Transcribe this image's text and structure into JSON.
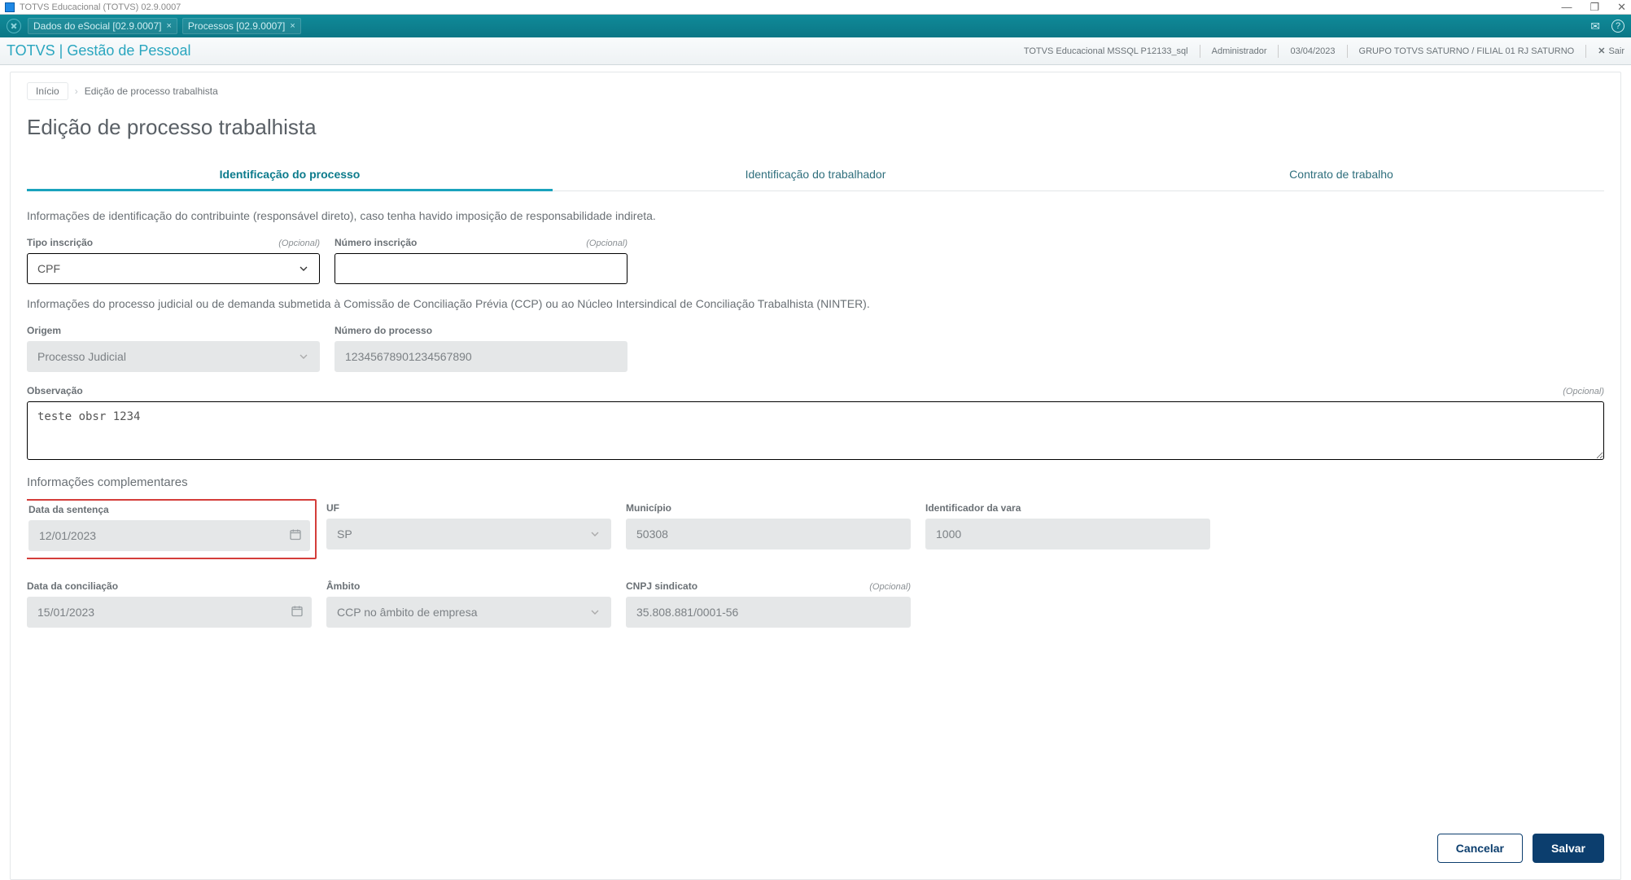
{
  "window": {
    "title": "TOTVS Educacional (TOTVS) 02.9.0007"
  },
  "ribbon": {
    "tabs": [
      {
        "label": "Dados do eSocial [02.9.0007]"
      },
      {
        "label": "Processos [02.9.0007]"
      }
    ]
  },
  "header": {
    "brand": "TOTVS | Gestão de Pessoal",
    "env": "TOTVS Educacional MSSQL P12133_sql",
    "user": "Administrador",
    "date": "03/04/2023",
    "company": "GRUPO TOTVS SATURNO / FILIAL 01 RJ SATURNO",
    "logout": "Sair"
  },
  "breadcrumb": {
    "home": "Início",
    "current": "Edição de processo trabalhista"
  },
  "page": {
    "title": "Edição de processo trabalhista"
  },
  "tabs": {
    "t1": "Identificação do processo",
    "t2": "Identificação do trabalhador",
    "t3": "Contrato de trabalho"
  },
  "form": {
    "section1_text": "Informações de identificação do contribuinte (responsável direto), caso tenha havido imposição de responsabilidade indireta.",
    "tipo_inscricao_lbl": "Tipo inscrição",
    "tipo_inscricao_opt": "(Opcional)",
    "tipo_inscricao_val": "CPF",
    "numero_inscricao_lbl": "Número inscrição",
    "numero_inscricao_opt": "(Opcional)",
    "numero_inscricao_val": "",
    "section2_text": "Informações do processo judicial ou de demanda submetida à Comissão de Conciliação Prévia (CCP) ou ao Núcleo Intersindical de Conciliação Trabalhista (NINTER).",
    "origem_lbl": "Origem",
    "origem_val": "Processo Judicial",
    "numero_processo_lbl": "Número do processo",
    "numero_processo_val": "12345678901234567890",
    "observacao_lbl": "Observação",
    "observacao_opt": "(Opcional)",
    "observacao_val": "teste obsr 1234",
    "section3_head": "Informações complementares",
    "data_sentenca_lbl": "Data da sentença",
    "data_sentenca_val": "12/01/2023",
    "uf_lbl": "UF",
    "uf_val": "SP",
    "municipio_lbl": "Município",
    "municipio_val": "50308",
    "ident_vara_lbl": "Identificador da vara",
    "ident_vara_val": "1000",
    "data_conciliacao_lbl": "Data da conciliação",
    "data_conciliacao_val": "15/01/2023",
    "ambito_lbl": "Âmbito",
    "ambito_val": "CCP no âmbito de empresa",
    "cnpj_sind_lbl": "CNPJ sindicato",
    "cnpj_sind_opt": "(Opcional)",
    "cnpj_sind_val": "35.808.881/0001-56"
  },
  "footer": {
    "cancel": "Cancelar",
    "save": "Salvar"
  }
}
